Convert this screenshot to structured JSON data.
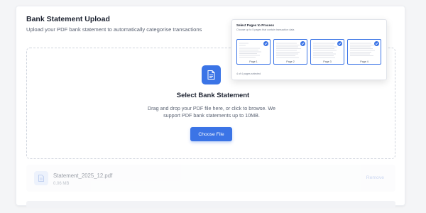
{
  "header": {
    "title": "Bank Statement Upload",
    "subtitle": "Upload your PDF bank statement to automatically categorise transactions"
  },
  "dropzone": {
    "icon": "document-icon",
    "heading": "Select Bank Statement",
    "description": "Drag and drop your PDF file here, or click to browse. We support PDF bank statements up to 10MB.",
    "button_label": "Choose File"
  },
  "file": {
    "icon": "file-icon",
    "name": "Statement_2025_12.pdf",
    "size": "0.06 MB",
    "remove_label": "Remove"
  },
  "page_selector": {
    "title": "Select Pages to Process",
    "subtitle": "Choose up to 5 pages that contain transaction data",
    "pages": [
      {
        "label": "Page 1",
        "selected": true
      },
      {
        "label": "Page 2",
        "selected": true
      },
      {
        "label": "Page 3",
        "selected": true
      },
      {
        "label": "Page 4",
        "selected": true
      }
    ],
    "footer": "4 of 4 pages selected"
  },
  "colors": {
    "accent": "#3b74e6",
    "background": "#f4f5f7"
  }
}
